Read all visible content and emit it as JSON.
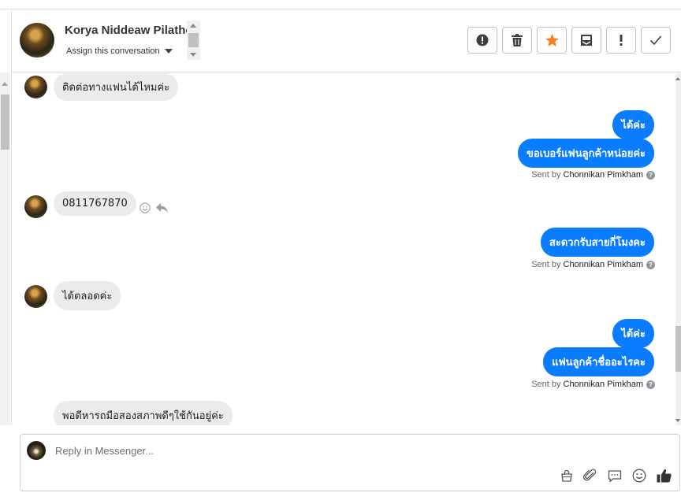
{
  "header": {
    "contact_name": "Korya Niddeaw Pilathep",
    "assign_label": "Assign this conversation"
  },
  "actions": [
    {
      "name": "alert-button",
      "icon": "exclamation-circle-icon"
    },
    {
      "name": "delete-button",
      "icon": "trash-icon"
    },
    {
      "name": "star-button",
      "icon": "star-icon",
      "color": "#f5821f"
    },
    {
      "name": "archive-button",
      "icon": "archive-inbox-icon"
    },
    {
      "name": "spam-button",
      "icon": "exclamation-icon"
    },
    {
      "name": "done-button",
      "icon": "check-icon"
    }
  ],
  "messages": [
    {
      "from": "contact",
      "text": "ติดต่อทางแฟนได้ไหมค่ะ"
    },
    {
      "from": "agent",
      "text": "ได้ค่ะ"
    },
    {
      "from": "agent",
      "text": "ขอเบอร์แฟนลูกค้าหน่อยค่ะ"
    },
    {
      "from": "contact",
      "text": "0811767870"
    },
    {
      "from": "agent",
      "text": "สะดวกรับสายกี่โมงคะ"
    },
    {
      "from": "contact",
      "text": "ได้ตลอดค่ะ"
    },
    {
      "from": "agent",
      "text": "ได้ค่ะ"
    },
    {
      "from": "agent",
      "text": "แฟนลูกค้าชื่ออะไรคะ"
    },
    {
      "from": "contact",
      "text": "พอดีหารถมือสองสภาพดีๆใช้กันอยู่ค่ะ"
    }
  ],
  "sent_by": {
    "prefix": "Sent by",
    "agent_name": "Chonnikan Pimkham",
    "help_glyph": "?"
  },
  "composer": {
    "placeholder": "Reply in Messenger...",
    "tools": [
      "shop-bag-icon",
      "paperclip-icon",
      "saved-reply-icon",
      "emoji-icon",
      "thumbs-up-icon"
    ]
  },
  "colors": {
    "outgoing_bubble": "#0a7cff",
    "incoming_bubble": "#ebebeb",
    "star": "#f5821f"
  }
}
